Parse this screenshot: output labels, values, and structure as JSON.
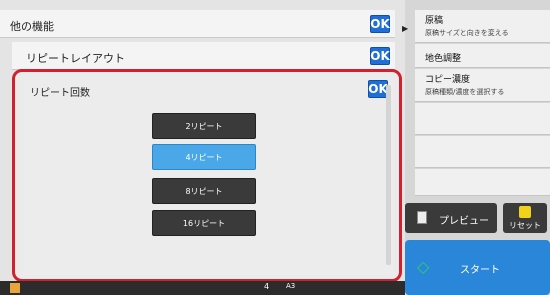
{
  "settings_rows": [
    {
      "label": "他の機能",
      "ok": "OK"
    },
    {
      "label": "リピートレイアウト",
      "ok": "OK"
    }
  ],
  "dialog": {
    "title": "リピート回数",
    "ok": "OK",
    "options": [
      {
        "label": "2リピート",
        "selected": false
      },
      {
        "label": "4リピート",
        "selected": true
      },
      {
        "label": "8リピート",
        "selected": false
      },
      {
        "label": "16リピート",
        "selected": false
      }
    ]
  },
  "right_panel": {
    "items": [
      {
        "title": "原稿",
        "subtitle": "原稿サイズと向きを変える"
      },
      {
        "title": "地色調整",
        "subtitle": ""
      },
      {
        "title": "コピー濃度",
        "subtitle": "原稿種類/濃度を選択する"
      }
    ],
    "preview_label": "プレビュー",
    "reset_label": "リセット",
    "start_label": "スタート"
  },
  "bottom_strip": {
    "page_num": "4",
    "paper": "A3"
  },
  "colors": {
    "accent": "#1f6fd6",
    "highlight_border": "#d2202e",
    "selected_option": "#4aa7e8",
    "start": "#2a86d8"
  }
}
